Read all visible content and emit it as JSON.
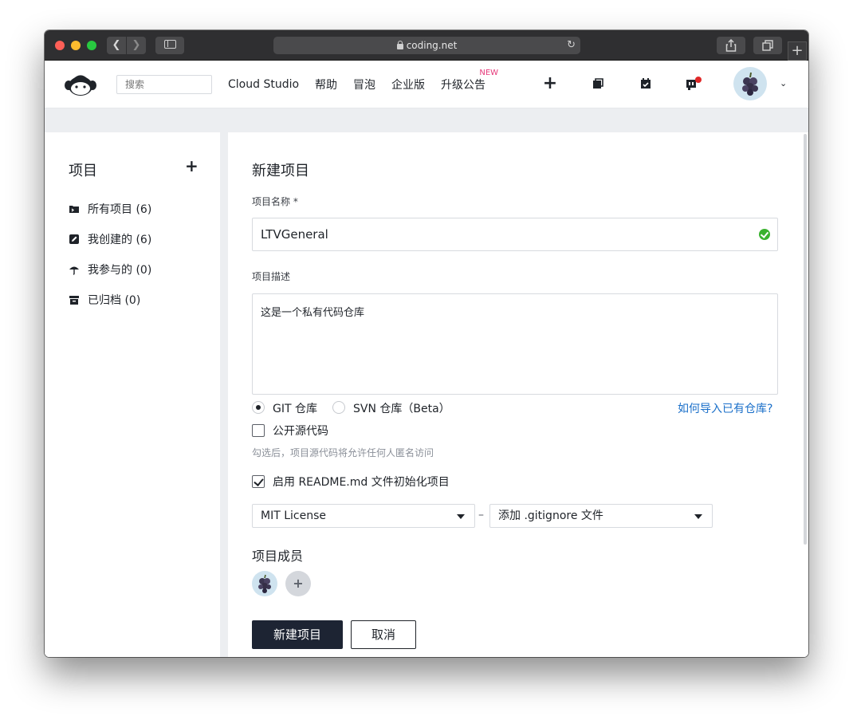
{
  "browser": {
    "url": "coding.net",
    "icons": [
      "back-icon",
      "forward-icon",
      "sidebar-icon",
      "lock-icon",
      "reload-icon",
      "share-icon",
      "tabs-icon",
      "new-tab-icon"
    ]
  },
  "header": {
    "search_placeholder": "搜索",
    "nav": [
      {
        "label": "Cloud Studio"
      },
      {
        "label": "帮助"
      },
      {
        "label": "冒泡"
      },
      {
        "label": "企业版"
      },
      {
        "label": "升级公告",
        "badge": "NEW"
      }
    ],
    "icons": [
      "plus-icon",
      "copy-icon",
      "calendar-check-icon",
      "notification-icon",
      "avatar",
      "chevron-down-icon"
    ]
  },
  "sidebar": {
    "title": "项目",
    "add_label": "+",
    "items": [
      {
        "label": "所有项目 (6)",
        "icon": "folder-code-icon"
      },
      {
        "label": "我创建的 (6)",
        "icon": "edit-icon"
      },
      {
        "label": "我参与的 (0)",
        "icon": "umbrella-icon"
      },
      {
        "label": "已归档 (0)",
        "icon": "archive-icon"
      }
    ]
  },
  "form": {
    "title": "新建项目",
    "name_label": "项目名称 *",
    "name_value": "LTVGeneral",
    "desc_label": "项目描述",
    "desc_value": "这是一个私有代码仓库",
    "repo_git": "GIT 仓库",
    "repo_svn": "SVN 仓库（Beta）",
    "repo_selected": "GIT 仓库",
    "import_link": "如何导入已有仓库?",
    "public_label": "公开源代码",
    "public_checked": false,
    "public_hint": "勾选后，项目源代码将允许任何人匿名访问",
    "readme_label": "启用 README.md 文件初始化项目",
    "readme_checked": true,
    "license_value": "MIT License",
    "separator": "–",
    "gitignore_value": "添加 .gitignore 文件",
    "members_label": "项目成员",
    "add_member": "+",
    "submit_label": "新建项目",
    "cancel_label": "取消"
  },
  "colors": {
    "primary_button": "#1d2433",
    "link": "#1a6fc9",
    "success": "#3ab22f",
    "new_badge": "#e6397a",
    "background": "#eceef1"
  }
}
